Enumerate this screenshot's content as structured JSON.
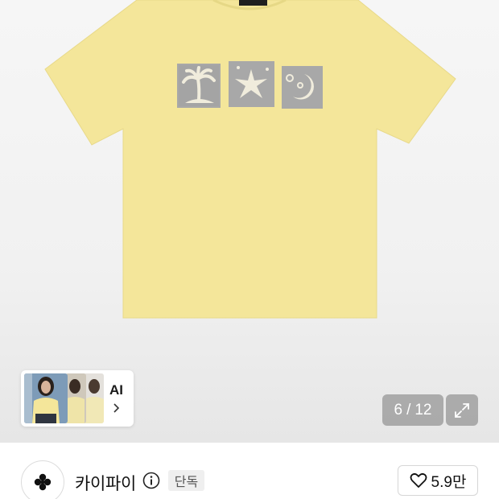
{
  "gallery": {
    "current_page": "6",
    "separator": "/",
    "total_pages": "12",
    "ai_label": "AI"
  },
  "seller": {
    "name": "카이파이",
    "badge": "단독",
    "likes": "5.9만"
  },
  "colors": {
    "shirt": "#f4e69a",
    "print": "#a9a9a9",
    "pager_bg": "#8a8a8a"
  },
  "icons": {
    "expand": "expand-icon",
    "info": "info-icon",
    "heart": "heart-icon",
    "logo": "club-logo-icon",
    "chevron": "chevron-right-icon"
  }
}
